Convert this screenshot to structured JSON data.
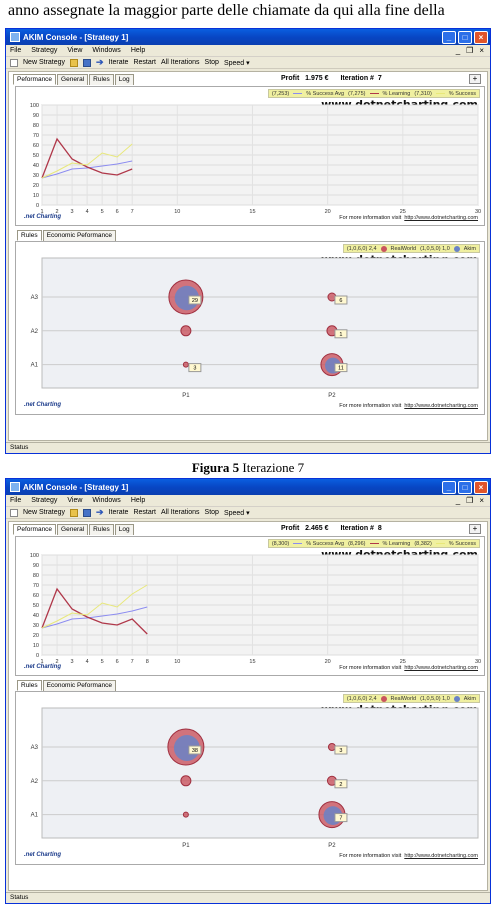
{
  "doc": {
    "top_text": "anno assegnate la maggior parte delle chiamate da qui alla fine della",
    "caption1_bold": "Figura 5",
    "caption1_rest": " Iterazione 7"
  },
  "colors": {
    "title_blue": "#0846c4",
    "learning": "#b0384a",
    "success_avg": "#8c8cf0",
    "success": "#e8e87a",
    "bubble_red": "#c9545e",
    "bubble_blue": "#6a83c7"
  },
  "windows": [
    {
      "title": "AKIM Console - [Strategy 1]",
      "menu": [
        "File",
        "Strategy",
        "View",
        "Windows",
        "Help"
      ],
      "toolbar": {
        "new": "New Strategy",
        "iterate": "Iterate",
        "restart": "Restart",
        "all": "All Iterations",
        "stop": "Stop",
        "speed": "Speed"
      },
      "tabs": [
        "Peformance",
        "General",
        "Rules",
        "Log"
      ],
      "profit_label": "Profit",
      "profit_value": "1.975 €",
      "iteration_label": "Iteration #",
      "iteration_value": "7",
      "plus": "+",
      "legend": {
        "avg": "(7,253)",
        "avg_label": "% Success Avg",
        "learn": "(7,275)",
        "learn_label": "% Learning",
        "succ": "(7,310)",
        "succ_label": "% Success"
      },
      "watermark": "www.dotnetcharting.com",
      "watermark_sub": "Development Version: Not for production use.",
      "footer_text": "For more information visit",
      "footer_link": "http://www.dotnetcharting.com",
      "logo": ".net Charting",
      "subtabs": [
        "Rules",
        "Economic Peformance"
      ],
      "bubble_legend": {
        "real": "(1,0,6,0) 2,4",
        "real_label": "RealWorld",
        "akim": "(1,0,5,0) 1,0",
        "akim_label": "Akim"
      },
      "bubble_labels": [
        "29",
        "6",
        "1",
        "3",
        "11"
      ],
      "y_cats": [
        "A3",
        "A2",
        "A1"
      ],
      "x_cats": [
        "P1",
        "P2"
      ],
      "status": "Status",
      "chart_data": {
        "type": "line",
        "x": [
          1,
          2,
          3,
          4,
          5,
          6,
          7
        ],
        "xlim": [
          1,
          30
        ],
        "ylim": [
          0,
          100
        ],
        "xticks": [
          1,
          2,
          3,
          4,
          5,
          6,
          7,
          10,
          15,
          20,
          25,
          30
        ],
        "yticks": [
          0,
          10,
          20,
          30,
          40,
          50,
          60,
          70,
          80,
          90,
          100
        ],
        "series": [
          {
            "name": "% Success Avg",
            "values": [
              27,
              31,
              36,
              37,
              39,
              41,
              44
            ]
          },
          {
            "name": "% Learning",
            "values": [
              27,
              66,
              46,
              38,
              32,
              30,
              36
            ]
          },
          {
            "name": "% Success",
            "values": [
              27,
              34,
              42,
              40,
              52,
              48,
              61
            ]
          }
        ]
      }
    },
    {
      "title": "AKIM Console - [Strategy 1]",
      "menu": [
        "File",
        "Strategy",
        "View",
        "Windows",
        "Help"
      ],
      "toolbar": {
        "new": "New Strategy",
        "iterate": "Iterate",
        "restart": "Restart",
        "all": "All Iterations",
        "stop": "Stop",
        "speed": "Speed"
      },
      "tabs": [
        "Peformance",
        "General",
        "Rules",
        "Log"
      ],
      "profit_label": "Profit",
      "profit_value": "2.465 €",
      "iteration_label": "Iteration #",
      "iteration_value": "8",
      "plus": "+",
      "legend": {
        "avg": "(8,300)",
        "avg_label": "% Success Avg",
        "learn": "(8,296)",
        "learn_label": "% Learning",
        "succ": "(8,382)",
        "succ_label": "% Success"
      },
      "watermark": "www.dotnetcharting.com",
      "watermark_sub": "Development Version: Not for production use.",
      "footer_text": "For more information visit",
      "footer_link": "http://www.dotnetcharting.com",
      "logo": ".net Charting",
      "subtabs": [
        "Rules",
        "Economic Peformance"
      ],
      "bubble_legend": {
        "real": "(1,0,6,0) 2,4",
        "real_label": "RealWorld",
        "akim": "(1,0,5,0) 1,0",
        "akim_label": "Akim"
      },
      "bubble_labels": [
        "38",
        "3",
        "2",
        "7"
      ],
      "y_cats": [
        "A3",
        "A2",
        "A1"
      ],
      "x_cats": [
        "P1",
        "P2"
      ],
      "status": "Status",
      "chart_data": {
        "type": "line",
        "x": [
          1,
          2,
          3,
          4,
          5,
          6,
          7,
          8
        ],
        "xlim": [
          1,
          30
        ],
        "ylim": [
          0,
          100
        ],
        "xticks": [
          1,
          2,
          3,
          4,
          5,
          6,
          7,
          8,
          10,
          15,
          20,
          25,
          30
        ],
        "yticks": [
          0,
          10,
          20,
          30,
          40,
          50,
          60,
          70,
          80,
          90,
          100
        ],
        "series": [
          {
            "name": "% Success Avg",
            "values": [
              27,
              31,
              36,
              37,
              39,
              41,
              44,
              48
            ]
          },
          {
            "name": "% Learning",
            "values": [
              27,
              66,
              46,
              38,
              32,
              30,
              36,
              21
            ]
          },
          {
            "name": "% Success",
            "values": [
              27,
              34,
              42,
              40,
              52,
              48,
              61,
              70
            ]
          }
        ]
      }
    }
  ]
}
